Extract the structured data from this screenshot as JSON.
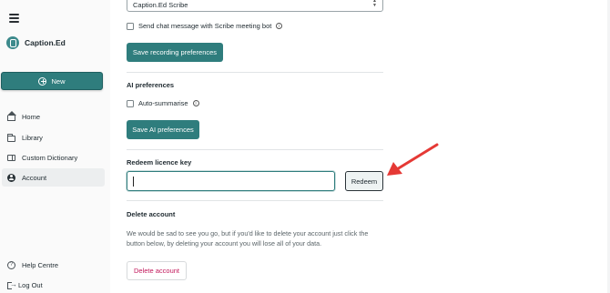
{
  "app": {
    "brand_name": "Caption.Ed"
  },
  "sidebar": {
    "new_label": "New",
    "items": [
      {
        "label": "Home",
        "icon": "home-icon"
      },
      {
        "label": "Library",
        "icon": "folder-icon"
      },
      {
        "label": "Custom Dictionary",
        "icon": "book-icon"
      },
      {
        "label": "Account",
        "icon": "account-icon",
        "active": true
      }
    ],
    "footer": [
      {
        "label": "Help Centre",
        "icon": "help-icon"
      },
      {
        "label": "Log Out",
        "icon": "logout-icon"
      }
    ]
  },
  "recording": {
    "bot_name_value": "Caption.Ed Scribe",
    "send_chat_label": "Send chat message with Scribe meeting bot",
    "send_chat_checked": false,
    "save_label": "Save recording preferences"
  },
  "ai": {
    "heading": "AI preferences",
    "auto_summarise_label": "Auto-summarise",
    "auto_summarise_checked": false,
    "save_label": "Save AI preferences"
  },
  "licence": {
    "heading": "Redeem licence key",
    "input_value": "",
    "redeem_label": "Redeem"
  },
  "delete": {
    "heading": "Delete account",
    "description": "We would be sad to see you go, but if you'd like to delete your account just click the button below, by deleting your account you will lose all of your data.",
    "button_label": "Delete account"
  },
  "colors": {
    "accent": "#2f7d7d",
    "danger": "#c2185b",
    "annotation_arrow": "#e53935"
  }
}
